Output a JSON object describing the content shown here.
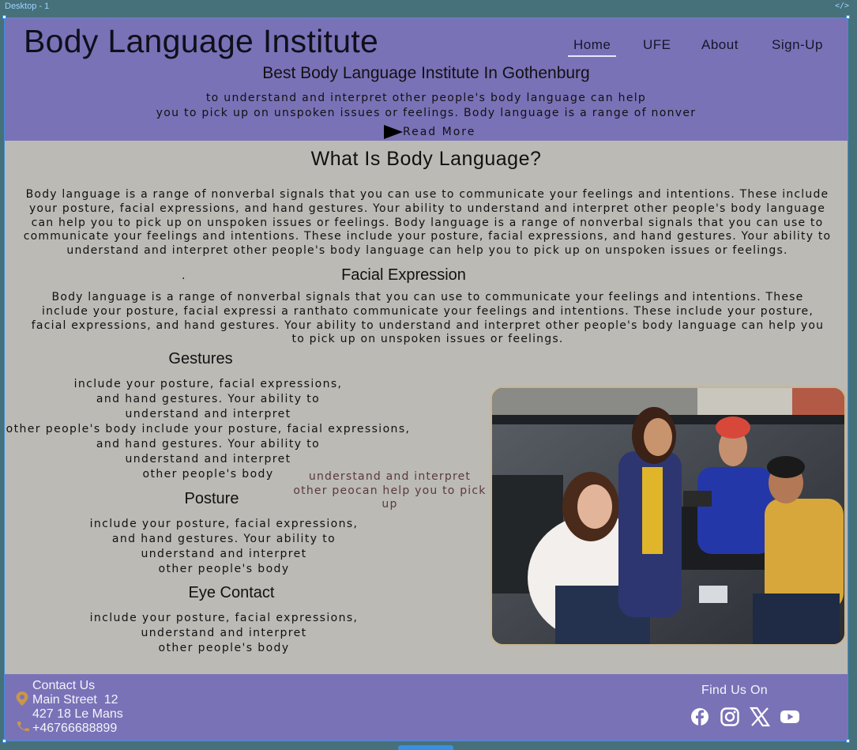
{
  "canvas": {
    "frame_label": "Desktop - 1"
  },
  "header": {
    "title": "Body Language Institute",
    "nav": [
      {
        "label": "Home",
        "active": true
      },
      {
        "label": "UFE",
        "active": false
      },
      {
        "label": "About",
        "active": false
      },
      {
        "label": "Sign-Up",
        "active": false
      }
    ],
    "tagline": "Best Body Language Institute In Gothenburg",
    "intro_line1": "to understand and interpret other people's body language can help",
    "intro_line2": "you to pick up on unspoken issues or feelings. Body language is a range of nonver",
    "read_more": "Read More"
  },
  "main": {
    "heading": "What Is Body Language?",
    "paragraph1": "Body language is a range of nonverbal signals that you can use to communicate your feelings and intentions. These include your posture, facial expressions, and hand gestures. Your ability to understand and interpret other people's body language can help you to pick up on unspoken issues or feelings. Body language is a range of nonverbal signals that you can use to communicate your feelings and intentions. These include your posture, facial expressions, and hand gestures. Your ability to understand and interpret other people's body language can help you to pick up on unspoken issues or feelings.",
    "dot": ".",
    "facial_heading": "Facial Expression",
    "paragraph2": "Body language is a range of nonverbal signals that you can use to communicate your feelings and intentions. These include your posture, facial expressi a ranthato communicate your feelings and intentions. These include your posture, facial expressions, and hand gestures. Your ability to understand and interpret other people's body language can help you to pick up on unspoken issues or feelings.",
    "gestures_heading": "Gestures",
    "gestures_text": "include your posture, facial expressions,\nand hand gestures. Your ability to\nunderstand and interpret\nother people's body include your posture, facial expressions,\nand hand gestures. Your ability to\nunderstand and interpret\nother people's body",
    "posture_heading": "Posture",
    "posture_text": "include your posture, facial expressions,\nand hand gestures. Your ability to\nunderstand and interpret\nother people's body",
    "eye_heading": "Eye Contact",
    "eye_text": "include your posture, facial expressions,\nunderstand and interpret\nother people's body",
    "floating_text": "understand and interpret\nother peocan help you to pick\nup"
  },
  "footer": {
    "contact_title": "Contact Us",
    "street": "Main Street  12",
    "city": "427 18 Le Mans",
    "phone": "+46766688899",
    "find_us": "Find Us On",
    "socials": [
      "facebook-icon",
      "instagram-icon",
      "x-icon",
      "youtube-icon"
    ]
  },
  "colors": {
    "header_bg": "#7a72b7",
    "body_bg": "#bcbab5",
    "accent_icon": "#c9964a"
  }
}
